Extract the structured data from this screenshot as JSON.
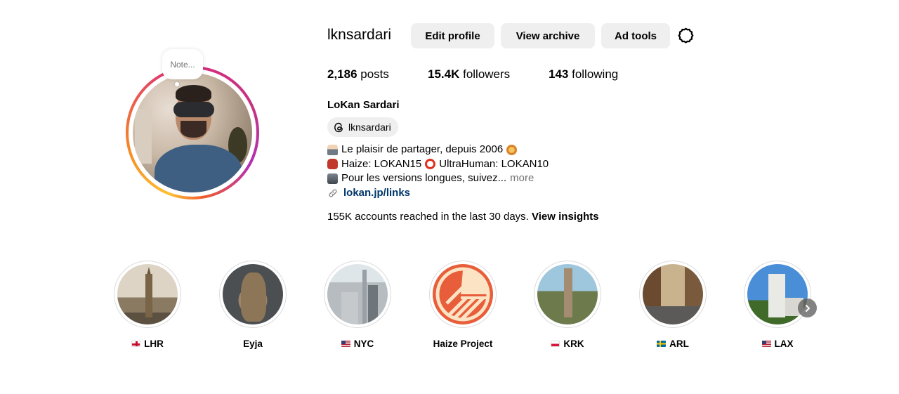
{
  "profile": {
    "username": "lknsardari",
    "note_placeholder": "Note...",
    "full_name": "LoKan Sardari",
    "threads_handle": "lknsardari",
    "buttons": {
      "edit_profile": "Edit profile",
      "view_archive": "View archive",
      "ad_tools": "Ad tools"
    },
    "stats": {
      "posts_count": "2,186",
      "posts_label": " posts",
      "followers_count": "15.4K",
      "followers_label": " followers",
      "following_count": "143",
      "following_label": " following"
    },
    "bio": {
      "line1": "Le plaisir de partager, depuis 2006",
      "line2_a": "Haize: LOKAN15",
      "line2_b": "UltraHuman: LOKAN10",
      "line3": "Pour les versions longues, suivez...",
      "more": "more",
      "link": "lokan.jp/links"
    },
    "insights": {
      "text": "155K accounts reached in the last 30 days. ",
      "link": "View insights"
    }
  },
  "highlights": [
    {
      "label": "LHR",
      "flag": "gb"
    },
    {
      "label": "Eyja",
      "flag": ""
    },
    {
      "label": "NYC",
      "flag": "us"
    },
    {
      "label": "Haize Project",
      "flag": ""
    },
    {
      "label": "KRK",
      "flag": "pl"
    },
    {
      "label": "ARL",
      "flag": "se"
    },
    {
      "label": "LAX",
      "flag": "us"
    }
  ],
  "colors": {
    "button_bg": "#efefef",
    "link": "#00376b",
    "muted": "#737373",
    "haize_orange": "#e85d3a",
    "haize_cream": "#fbe3c4"
  }
}
